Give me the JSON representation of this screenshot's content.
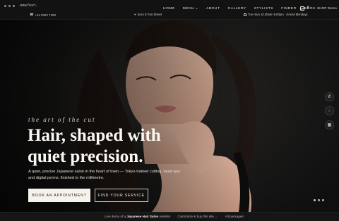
{
  "window": {
    "title": "Japanese Hair Salon"
  },
  "brand": {
    "logo_text": "ameliori."
  },
  "topbar": {
    "phone": "+44 0322 7100",
    "location": "Soro 8 Yuri Street",
    "hours": "Tue–Sun 10.00am–8.00pm · closed Mondays"
  },
  "nav": {
    "items": [
      "HOME",
      "MENU",
      "ABOUT",
      "GALLERY",
      "STYLISTS",
      "FINDER",
      "BOOK"
    ],
    "shop_label": "SHOP Demo"
  },
  "hero": {
    "tagline": "the art of the cut",
    "headline_line1": "Hair, shaped with",
    "headline_line2": "quiet precision.",
    "subtext": "A quiet, precise Japanese salon in the heart of town — Tokyo-trained cutting, head spa and digital perms, finished to the millimetre.",
    "book_label": "BOOK AN APPOINTMENT",
    "find_label": "FIND YOUR SERVICE"
  },
  "side_actions": [
    "phone-icon",
    "chat-icon",
    "calendar-icon"
  ],
  "pager": {
    "count": 3,
    "active": 0
  },
  "bottom": {
    "prefix": "Live demo of a",
    "product": "Japanese Hair Salon",
    "mid": "website",
    "customize": "Customize & buy this site →",
    "all": "All packages"
  }
}
